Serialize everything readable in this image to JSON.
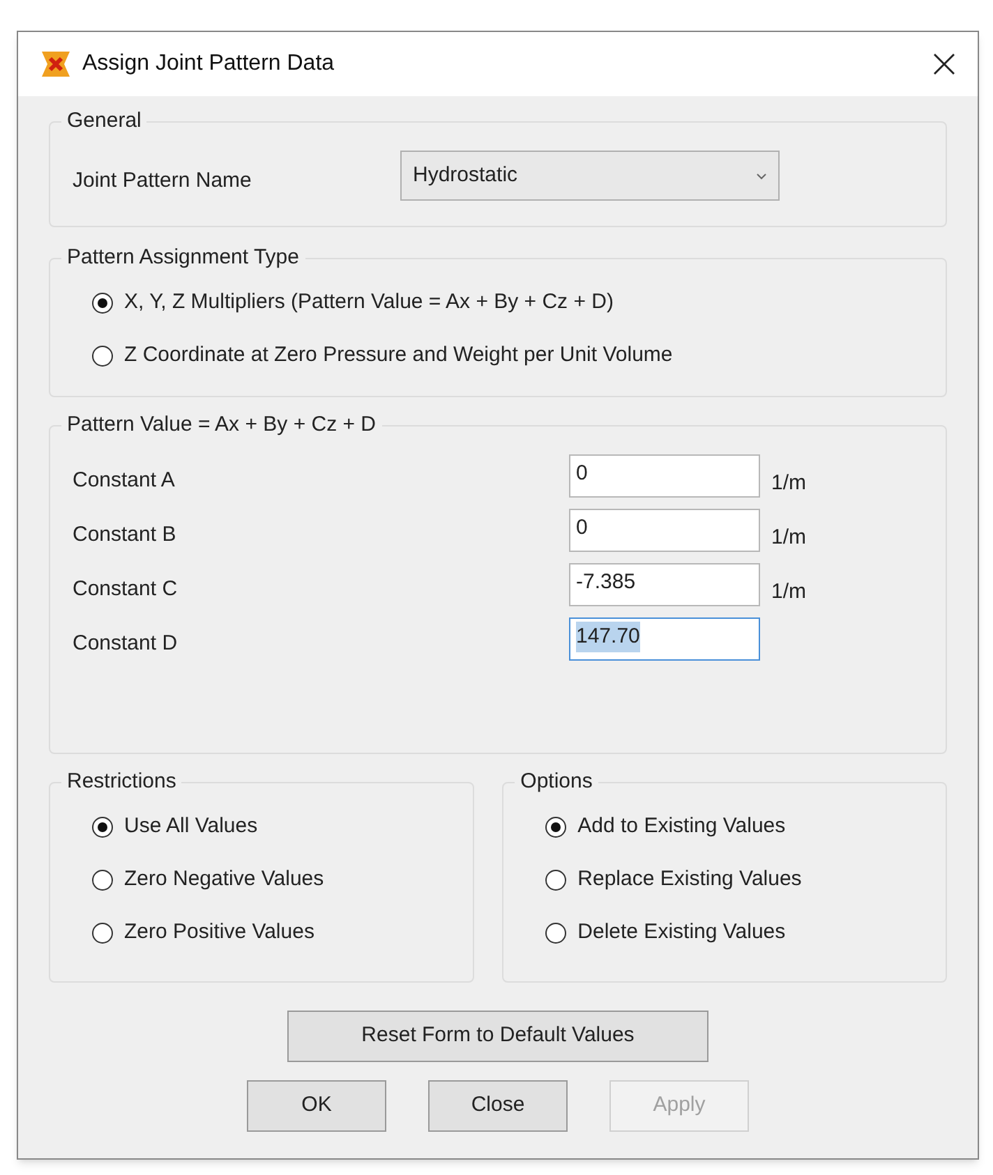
{
  "window": {
    "title": "Assign Joint Pattern Data"
  },
  "general": {
    "title": "General",
    "label": "Joint Pattern Name",
    "value": "Hydrostatic"
  },
  "assignment": {
    "title": "Pattern Assignment Type",
    "options": [
      {
        "label": "X, Y, Z Multipliers  (Pattern Value = Ax + By + Cz + D)",
        "selected": true
      },
      {
        "label": "Z Coordinate at Zero Pressure and Weight per Unit Volume",
        "selected": false
      }
    ]
  },
  "pattern_value": {
    "title": "Pattern Value = Ax + By + Cz + D",
    "rows": [
      {
        "label": "Constant A",
        "value": "0",
        "unit": "1/m",
        "focused": false
      },
      {
        "label": "Constant B",
        "value": "0",
        "unit": "1/m",
        "focused": false
      },
      {
        "label": "Constant C",
        "value": "-7.385",
        "unit": "1/m",
        "focused": false
      },
      {
        "label": "Constant D",
        "value": "147.70",
        "focused": true
      }
    ]
  },
  "restrictions": {
    "title": "Restrictions",
    "options": [
      {
        "label": "Use All Values",
        "selected": true
      },
      {
        "label": "Zero Negative Values",
        "selected": false
      },
      {
        "label": "Zero Positive Values",
        "selected": false
      }
    ]
  },
  "options": {
    "title": "Options",
    "options": [
      {
        "label": "Add to Existing Values",
        "selected": true
      },
      {
        "label": "Replace Existing Values",
        "selected": false
      },
      {
        "label": "Delete Existing Values",
        "selected": false
      }
    ]
  },
  "reset_button": "Reset Form to Default Values",
  "buttons": [
    {
      "label": "OK",
      "disabled": false
    },
    {
      "label": "Close",
      "disabled": false
    },
    {
      "label": "Apply",
      "disabled": true
    }
  ]
}
